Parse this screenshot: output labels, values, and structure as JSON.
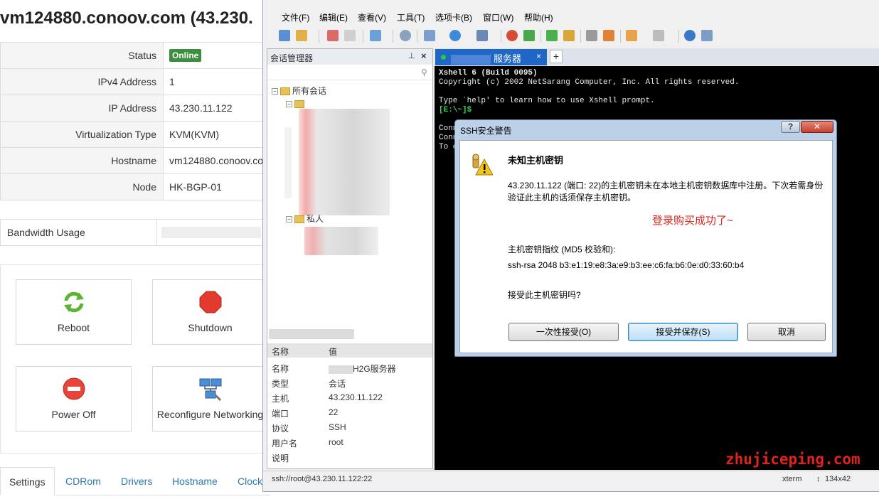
{
  "web": {
    "title": "vm124880.conoov.com (43.230.",
    "rows": [
      {
        "label": "Status",
        "value": "Online",
        "badge": true
      },
      {
        "label": "IPv4 Address",
        "value": "1"
      },
      {
        "label": "IP Address",
        "value": "43.230.11.122"
      },
      {
        "label": "Virtualization Type",
        "value": "KVM(KVM)"
      },
      {
        "label": "Hostname",
        "value": "vm124880.conoov.co"
      },
      {
        "label": "Node",
        "value": "HK-BGP-01"
      }
    ],
    "bandwidth_label": "Bandwidth Usage",
    "actions": {
      "reboot": "Reboot",
      "shutdown": "Shutdown",
      "power_off": "Power Off",
      "reconfigure": "Reconfigure Networking"
    },
    "tabs": [
      "Settings",
      "CDRom",
      "Drivers",
      "Hostname",
      "Clock"
    ]
  },
  "xshell": {
    "menu": [
      "文件(F)",
      "编辑(E)",
      "查看(V)",
      "工具(T)",
      "选项卡(B)",
      "窗口(W)",
      "帮助(H)"
    ],
    "session_manager_title": "会话管理器",
    "tree": {
      "root": "所有会话",
      "private": "私人"
    },
    "props": {
      "header_name": "名称",
      "header_value": "值",
      "rows": [
        {
          "k": "名称",
          "v": "H2G服务器"
        },
        {
          "k": "类型",
          "v": "会话"
        },
        {
          "k": "主机",
          "v": "43.230.11.122"
        },
        {
          "k": "端口",
          "v": "22"
        },
        {
          "k": "协议",
          "v": "SSH"
        },
        {
          "k": "用户名",
          "v": "root"
        },
        {
          "k": "说明",
          "v": ""
        }
      ]
    },
    "tab_label": "服务器",
    "terminal_lines": [
      "Xshell 6 (Build 0095)",
      "Copyright (c) 2002 NetSarang Computer, Inc. All rights reserved.",
      "Type `help' to learn how to use Xshell prompt.",
      "[E:\\~]$",
      "Conn",
      "Conn",
      "To e"
    ],
    "status": {
      "path": "ssh://root@43.230.11.122:22",
      "term": "xterm",
      "size": "134x42"
    }
  },
  "dialog": {
    "title": "SSH安全警告",
    "help": "?",
    "heading": "未知主机密钥",
    "desc": "43.230.11.122 (端口: 22)的主机密钥未在本地主机密钥数据库中注册。下次若需身份验证此主机的话须保存主机密钥。",
    "note": "登录购买成功了~",
    "fp_label": "主机密钥指纹 (MD5 校验和):",
    "fp": "ssh-rsa 2048 b3:e1:19:e8:3a:e9:b3:ee:c6:fa:b6:0e:d0:33:60:b4",
    "question": "接受此主机密钥吗?",
    "btn_once": "一次性接受(O)",
    "btn_save": "接受并保存(S)",
    "btn_cancel": "取消"
  },
  "watermark": "zhujiceping.com"
}
